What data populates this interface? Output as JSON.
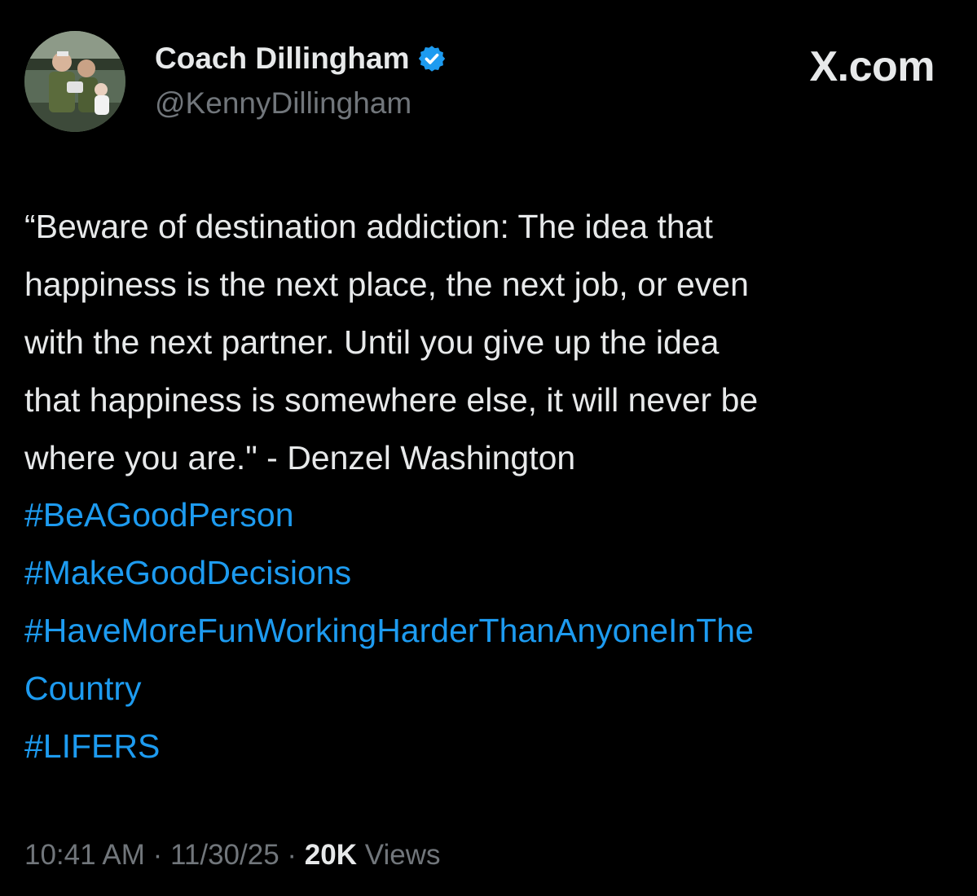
{
  "author": {
    "display_name": "Coach Dillingham",
    "handle": "@KennyDillingham",
    "verified_icon": "verified-badge-icon",
    "avatar_icon": "profile-photo"
  },
  "watermark": "X.com",
  "tweet": {
    "text_lines": [
      "“Beware of destination addiction: The idea that",
      "happiness is the next place, the next job, or even",
      "with the next partner. Until you give up the idea",
      "that happiness is somewhere else, it will never be",
      "where you are.\" - Denzel Washington"
    ],
    "hashtags": [
      "#BeAGoodPerson",
      "#MakeGoodDecisions",
      "#HaveMoreFunWorkingHarderThanAnyoneInThe",
      "Country",
      "#LIFERS"
    ]
  },
  "meta": {
    "time": "10:41 AM",
    "separator": "·",
    "date": "11/30/25",
    "views_count": "20K",
    "views_label": "Views"
  },
  "colors": {
    "background": "#000000",
    "text": "#e7e9ea",
    "secondary": "#71767b",
    "link": "#1d9bf0",
    "verified": "#1d9bf0"
  }
}
